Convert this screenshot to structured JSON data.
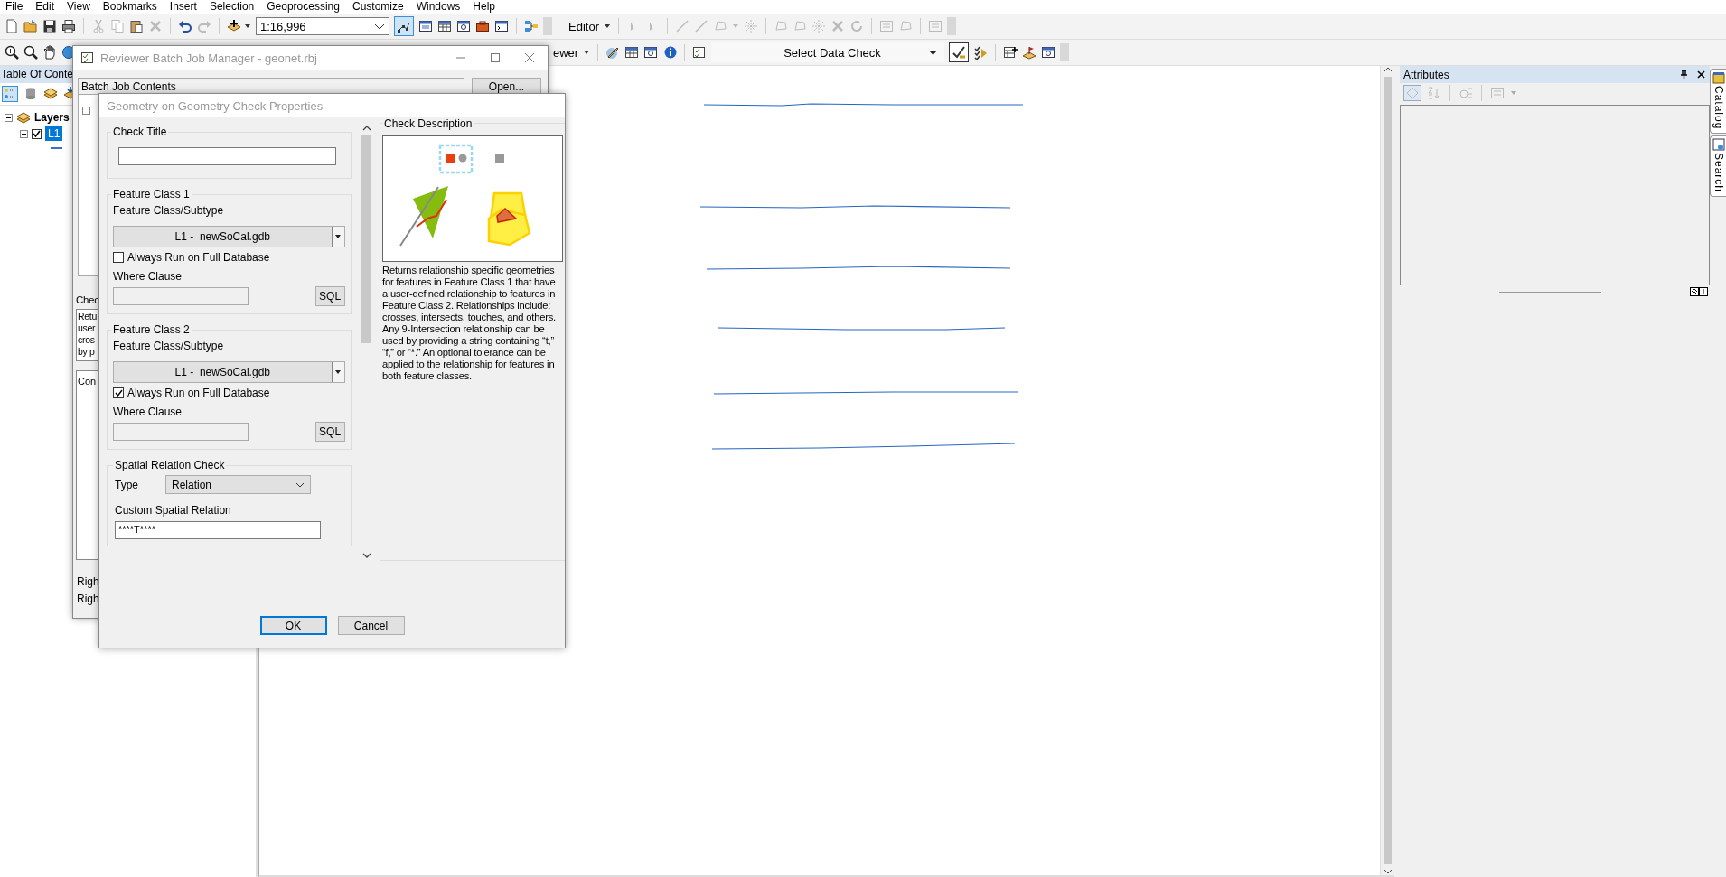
{
  "menu": [
    "File",
    "Edit",
    "View",
    "Bookmarks",
    "Insert",
    "Selection",
    "Geoprocessing",
    "Customize",
    "Windows",
    "Help"
  ],
  "toolbar": {
    "scale": "1:16,996",
    "editor": "Editor",
    "reviewer": "ewer",
    "data_check": "Select Data Check"
  },
  "toc": {
    "title": "Table Of Conte",
    "root": "Layers",
    "expanded": true,
    "layers": [
      {
        "name": "L1",
        "checked": true,
        "selected": true
      }
    ]
  },
  "batch_dialog": {
    "title": "Reviewer Batch Job Manager - geonet.rbj",
    "contents_label": "Batch Job Contents",
    "open_button": "Open...",
    "check_label": "Chec",
    "description_lines": [
      "Retu",
      "user",
      "cros",
      "by p"
    ],
    "config_label": "Con",
    "rows": [
      "Righ",
      "Righ"
    ]
  },
  "geom_dialog": {
    "title": "Geometry on Geometry Check Properties",
    "check_title_label": "Check Title",
    "feature_classes": [
      {
        "label": "Feature Class 1",
        "subtype_label": "Feature Class/Subtype",
        "value": "L1 -  newSoCal.gdb",
        "always_run_label": "Always Run on Full Database",
        "checked": false,
        "where_label": "Where Clause",
        "sql_button": "SQL"
      },
      {
        "label": "Feature Class 2",
        "subtype_label": "Feature Class/Subtype",
        "value": "L1 -  newSoCal.gdb",
        "always_run_label": "Always Run on Full Database",
        "checked": true,
        "where_label": "Where Clause",
        "sql_button": "SQL"
      }
    ],
    "spatial": {
      "label": "Spatial Relation Check",
      "type_label": "Type",
      "type_value": "Relation",
      "custom_label": "Custom Spatial Relation",
      "custom_value": "****T****"
    },
    "description": {
      "label": "Check Description",
      "text": "Returns relationship specific geometries for features in Feature Class 1 that have a user-defined relationship to features in Feature Class 2.  Relationships include: crosses, intersects, touches, and others. Any 9-Intersection relationship can be used by providing a string containing “t,” “f,” or “*.”  An optional tolerance can be applied to the relationship for features in both feature classes."
    },
    "buttons": [
      {
        "label": "OK",
        "default": true
      },
      {
        "label": "Cancel",
        "default": false
      }
    ]
  },
  "attributes": {
    "title": "Attributes"
  },
  "side_tabs": [
    "Catalog",
    "Search"
  ]
}
